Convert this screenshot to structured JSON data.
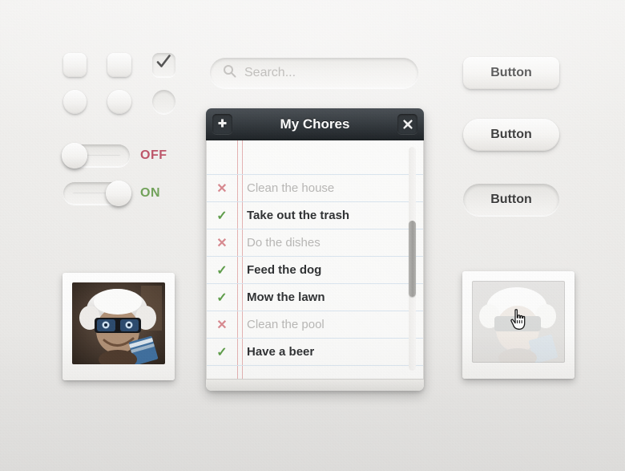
{
  "controls": {
    "checkboxes": [
      {
        "name": "checkbox-1",
        "state": "unchecked",
        "style": "raised"
      },
      {
        "name": "checkbox-2",
        "state": "unchecked",
        "style": "raised"
      },
      {
        "name": "checkbox-3",
        "state": "checked",
        "style": "inset"
      }
    ],
    "radios": [
      {
        "name": "radio-1",
        "state": "unselected",
        "style": "raised"
      },
      {
        "name": "radio-2",
        "state": "unselected",
        "style": "raised"
      },
      {
        "name": "radio-3",
        "state": "unselected",
        "style": "inset"
      }
    ],
    "check_glyph": "check-icon"
  },
  "toggles": [
    {
      "label": "OFF",
      "state": "off",
      "knob": "left",
      "color": "#bf566a"
    },
    {
      "label": "ON",
      "state": "on",
      "knob": "right",
      "color": "#72a35a"
    }
  ],
  "search": {
    "placeholder": "Search...",
    "value": "",
    "icon": "search-icon"
  },
  "buttons": [
    {
      "label": "Button",
      "style": "rounded-rect-raised"
    },
    {
      "label": "Button",
      "style": "pill-raised"
    },
    {
      "label": "Button",
      "style": "pill-pressed"
    }
  ],
  "panel": {
    "title": "My Chores",
    "add_icon": "plus-icon",
    "close_icon": "close-icon",
    "items": [
      {
        "label": "Clean the house",
        "done": false,
        "mark": "✕"
      },
      {
        "label": "Take out the trash",
        "done": true,
        "mark": "✓"
      },
      {
        "label": "Do the dishes",
        "done": false,
        "mark": "✕"
      },
      {
        "label": "Feed the dog",
        "done": true,
        "mark": "✓"
      },
      {
        "label": "Mow the lawn",
        "done": true,
        "mark": "✓"
      },
      {
        "label": "Clean the pool",
        "done": false,
        "mark": "✕"
      },
      {
        "label": "Have a beer",
        "done": true,
        "mark": "✓"
      }
    ],
    "scrollbar": {
      "name": "list-scrollbar",
      "thumb_position": "upper-middle"
    }
  },
  "photos": [
    {
      "name": "photo-frame-normal",
      "state": "normal",
      "alt": "cartoon scientist with white hair, dark glasses and blue book"
    },
    {
      "name": "photo-frame-hover",
      "state": "faded-hover",
      "alt": "same photo faded with pointing hand cursor",
      "cursor": "pointing-hand-cursor"
    }
  ],
  "colors": {
    "background": "#f1f0ee",
    "panel_header_dark": "#2c3237",
    "check_green": "#5f9e4a",
    "cross_red": "#d98a90",
    "rule_blue": "#dbe6f0",
    "margin_red": "#d67878"
  }
}
